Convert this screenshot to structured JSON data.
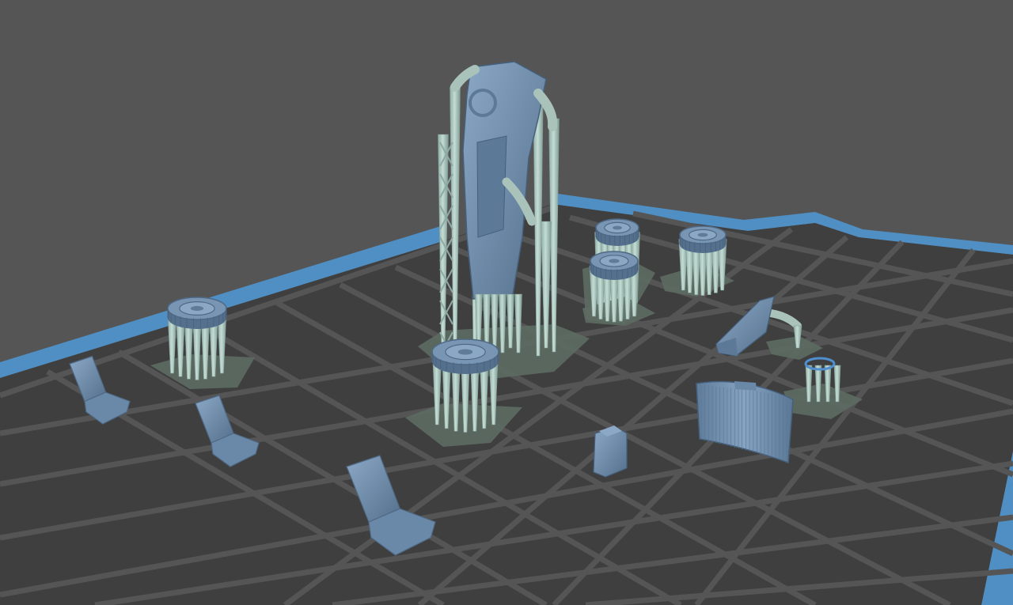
{
  "viewport": {
    "background_color": "#555555",
    "plate_color": "#3f3f3f",
    "grid_line_color": "#555555",
    "plate_edge_color": "#4f8fc4",
    "model_color": "#6f8fae",
    "model_dark": "#54708c",
    "support_color": "#a9c3bb",
    "support_dark": "#7e9c95",
    "raft_color": "#5d6b63"
  },
  "objects": [
    {
      "name": "car-body-on-supports",
      "kind": "body"
    },
    {
      "name": "wheel-on-supports",
      "kind": "wheel"
    },
    {
      "name": "wheel-on-supports",
      "kind": "wheel"
    },
    {
      "name": "wheel-on-supports",
      "kind": "wheel"
    },
    {
      "name": "wheel-on-supports",
      "kind": "wheel"
    },
    {
      "name": "wheel-on-supports",
      "kind": "wheel"
    },
    {
      "name": "seat",
      "kind": "seat"
    },
    {
      "name": "seat",
      "kind": "seat"
    },
    {
      "name": "seat",
      "kind": "seat"
    },
    {
      "name": "steering-wheel-on-supports",
      "kind": "steering"
    },
    {
      "name": "windshield-part",
      "kind": "panel"
    },
    {
      "name": "small-part",
      "kind": "box"
    },
    {
      "name": "lever-part-on-supports",
      "kind": "lever"
    }
  ]
}
